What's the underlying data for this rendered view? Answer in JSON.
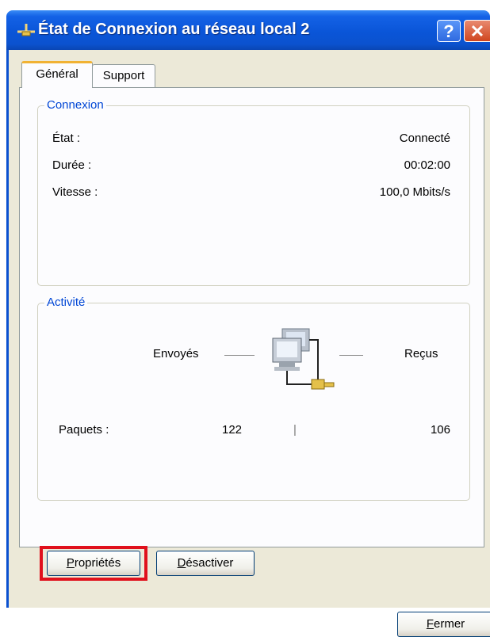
{
  "window": {
    "title": "État de Connexion au réseau local 2",
    "help_label": "?",
    "close_label": "✕"
  },
  "tabs": [
    {
      "label": "Général",
      "selected": true
    },
    {
      "label": "Support",
      "selected": false
    }
  ],
  "connexion": {
    "legend": "Connexion",
    "rows": [
      {
        "label": "État :",
        "value": "Connecté"
      },
      {
        "label": "Durée :",
        "value": "00:02:00"
      },
      {
        "label": "Vitesse :",
        "value": "100,0 Mbits/s"
      }
    ]
  },
  "activite": {
    "legend": "Activité",
    "sent_label": "Envoyés",
    "received_label": "Reçus",
    "packets_label": "Paquets :",
    "packets_sent": "122",
    "packets_received": "106",
    "separator": "|"
  },
  "buttons": {
    "properties_first": "P",
    "properties_rest": "ropriétés",
    "disable_first": "D",
    "disable_rest": "ésactiver",
    "close_first": "F",
    "close_rest": "ermer"
  },
  "colors": {
    "titlebar": "#0a55d8",
    "client_bg": "#ece9d8",
    "group_label": "#0046d5",
    "highlight": "#e0101c",
    "active_tab_accent": "#f1b233"
  }
}
